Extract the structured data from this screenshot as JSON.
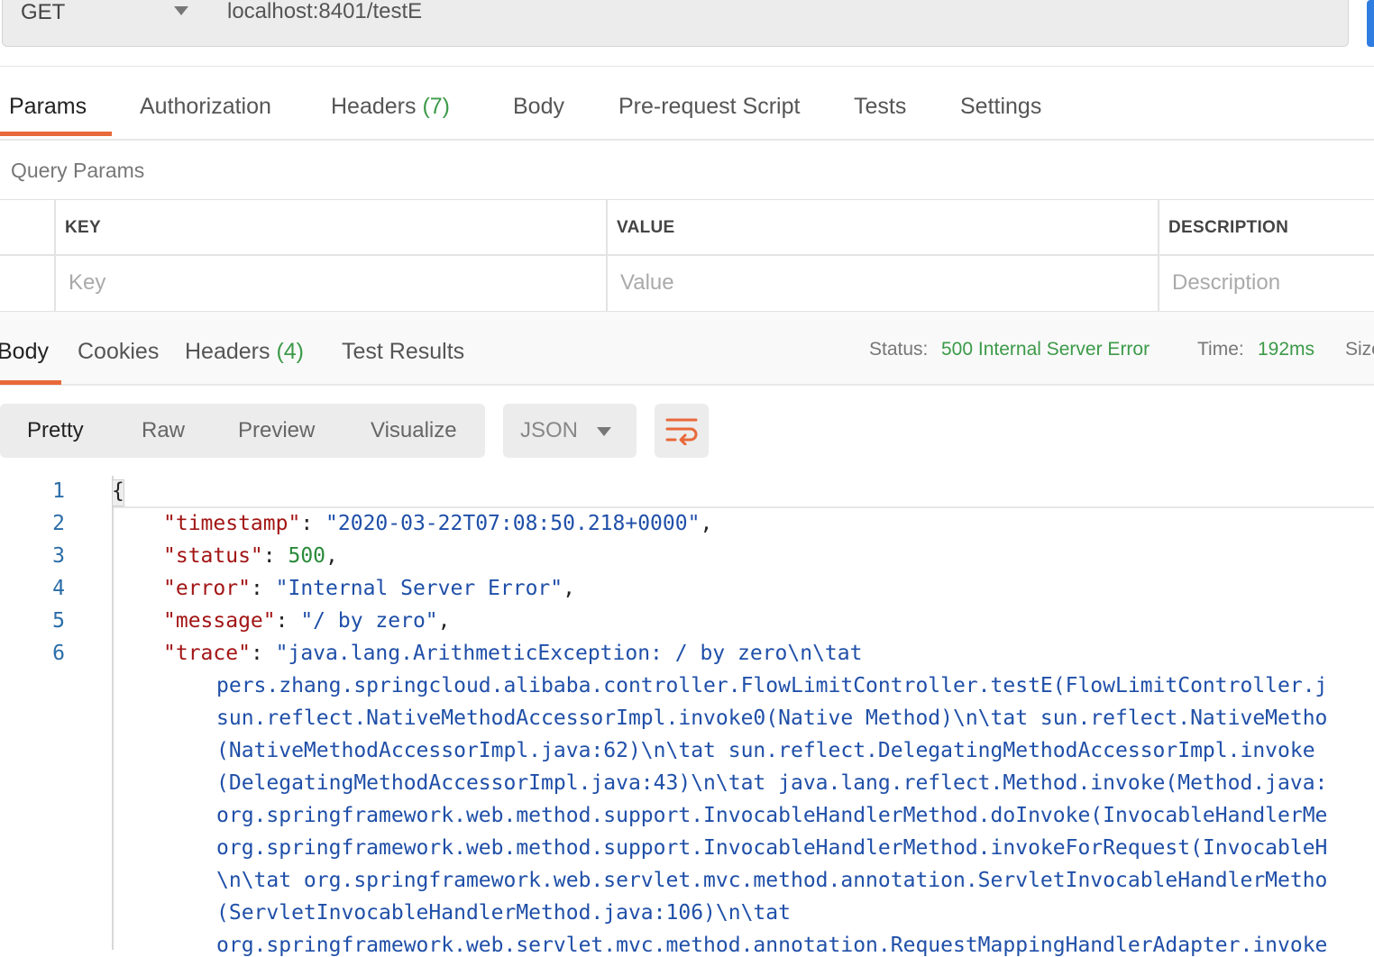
{
  "request": {
    "method": "GET",
    "url": "localhost:8401/testE"
  },
  "request_tabs": {
    "params": "Params",
    "authorization": "Authorization",
    "headers_label": "Headers",
    "headers_count": "(7)",
    "body": "Body",
    "pre_request": "Pre-request Script",
    "tests": "Tests",
    "settings": "Settings",
    "active": "Params"
  },
  "query_params": {
    "title": "Query Params",
    "columns": [
      "KEY",
      "VALUE",
      "DESCRIPTION"
    ],
    "placeholders": [
      "Key",
      "Value",
      "Description"
    ]
  },
  "response_tabs": {
    "body": "Body",
    "cookies": "Cookies",
    "headers_label": "Headers",
    "headers_count": "(4)",
    "test_results": "Test Results",
    "active": "Body"
  },
  "response_meta": {
    "status_label": "Status:",
    "status_value": "500 Internal Server Error",
    "time_label": "Time:",
    "time_value": "192ms",
    "size_label": "Size"
  },
  "view_modes": {
    "pretty": "Pretty",
    "raw": "Raw",
    "preview": "Preview",
    "visualize": "Visualize",
    "active": "Pretty"
  },
  "format": "JSON",
  "line_numbers": [
    "1",
    "2",
    "3",
    "4",
    "5",
    "6"
  ],
  "json_body": {
    "open_brace": "{",
    "timestamp_key": "\"timestamp\"",
    "timestamp_val": "\"2020-03-22T07:08:50.218+0000\"",
    "status_key": "\"status\"",
    "status_val": "500",
    "error_key": "\"error\"",
    "error_val": "\"Internal Server Error\"",
    "message_key": "\"message\"",
    "message_val": "\"/ by zero\"",
    "trace_key": "\"trace\"",
    "trace_lines": [
      "\"java.lang.ArithmeticException: / by zero\\n\\tat",
      "pers.zhang.springcloud.alibaba.controller.FlowLimitController.testE(FlowLimitController.j",
      "sun.reflect.NativeMethodAccessorImpl.invoke0(Native Method)\\n\\tat sun.reflect.NativeMetho",
      "(NativeMethodAccessorImpl.java:62)\\n\\tat sun.reflect.DelegatingMethodAccessorImpl.invoke",
      "(DelegatingMethodAccessorImpl.java:43)\\n\\tat java.lang.reflect.Method.invoke(Method.java:",
      "org.springframework.web.method.support.InvocableHandlerMethod.doInvoke(InvocableHandlerMe",
      "org.springframework.web.method.support.InvocableHandlerMethod.invokeForRequest(InvocableH",
      "\\n\\tat org.springframework.web.servlet.mvc.method.annotation.ServletInvocableHandlerMetho",
      "(ServletInvocableHandlerMethod.java:106)\\n\\tat",
      "org.springframework.web.servlet.mvc.method.annotation.RequestMappingHandlerAdapter.invoke"
    ]
  },
  "colors": {
    "accent": "#e8693a",
    "success": "#3c9a48",
    "send_button": "#2f7de1",
    "json_key": "#a31515",
    "json_string": "#1f4fa8",
    "json_number": "#2a8a3a"
  },
  "icons": {
    "method_dropdown": "chevron-down-icon",
    "format_dropdown": "chevron-down-icon",
    "wrap": "wrap-lines-icon"
  }
}
